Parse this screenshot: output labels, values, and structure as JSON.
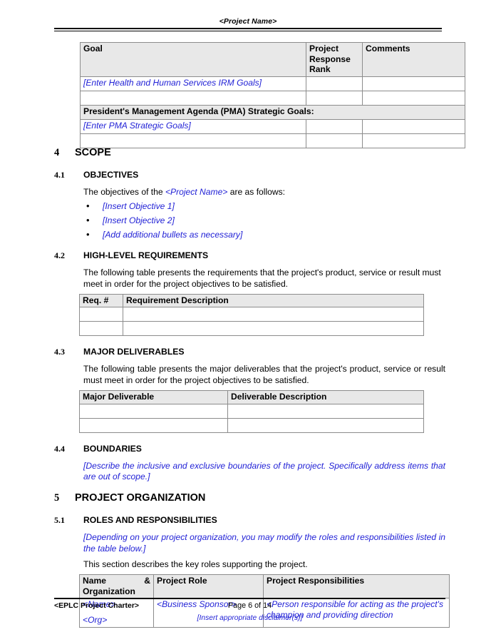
{
  "header": {
    "title": "<Project Name>"
  },
  "goals_table": {
    "columns": [
      "Goal",
      "Project Response Rank",
      "Comments"
    ],
    "col_project_rank_wrapped": "Project\nResponse\nRank",
    "rows": [
      {
        "type": "placeholder",
        "goal": "[Enter Health and Human Services IRM Goals]",
        "rank": "",
        "comments": ""
      },
      {
        "type": "blank",
        "goal": "",
        "rank": "",
        "comments": ""
      },
      {
        "type": "section",
        "goal": "President's Management Agenda (PMA) Strategic Goals:"
      },
      {
        "type": "placeholder",
        "goal": "[Enter PMA Strategic Goals]",
        "rank": "",
        "comments": ""
      },
      {
        "type": "blank",
        "goal": "",
        "rank": "",
        "comments": ""
      }
    ]
  },
  "sections": {
    "scope": {
      "number": "4",
      "title": "SCOPE",
      "objectives": {
        "number": "4.1",
        "title": "OBJECTIVES",
        "intro_before": "The objectives of the ",
        "intro_project": "<Project Name>",
        "intro_after": " are as follows:",
        "bullets": [
          "[Insert Objective 1]",
          "[Insert Objective 2]",
          "[Add additional bullets as necessary]"
        ]
      },
      "requirements": {
        "number": "4.2",
        "title": "HIGH-LEVEL REQUIREMENTS",
        "intro": "The following table presents the requirements that the project's product, service or result must meet in order for the project objectives to be satisfied.",
        "columns": [
          "Req. #",
          "Requirement Description"
        ],
        "rows": [
          [
            "",
            ""
          ],
          [
            "",
            ""
          ]
        ]
      },
      "deliverables": {
        "number": "4.3",
        "title": "MAJOR DELIVERABLES",
        "intro": "The following table presents the major deliverables that the project's product, service or result must meet in order for the project objectives to be satisfied.",
        "columns": [
          "Major Deliverable",
          "Deliverable Description"
        ],
        "rows": [
          [
            "",
            ""
          ],
          [
            "",
            ""
          ]
        ]
      },
      "boundaries": {
        "number": "4.4",
        "title": "BOUNDARIES",
        "placeholder": "[Describe the inclusive and exclusive boundaries of the project.  Specifically address items that are out of scope.]"
      }
    },
    "organization": {
      "number": "5",
      "title": "PROJECT ORGANIZATION",
      "roles": {
        "number": "5.1",
        "title": "ROLES AND RESPONSIBILITIES",
        "placeholder": "[Depending on your project organization, you may modify the roles and responsibilities listed in the table below.]",
        "intro": "This section describes the key roles supporting the project.",
        "columns": [
          "Name",
          "&",
          "Organization",
          "Project Role",
          "Project Responsibilities"
        ],
        "col1_part1": "Name",
        "col1_part2": "&",
        "col1_part3": "Organization",
        "col2": "Project Role",
        "col3": "Project Responsibilities",
        "rows": [
          {
            "name_line1": "<Name>",
            "name_line2": "<Org>",
            "role": "<Business Sponsor>",
            "responsibility": "<Person responsible for acting as the project's champion and providing direction"
          }
        ]
      }
    }
  },
  "footer": {
    "left": "<EPLC Project Charter>",
    "center": "Page 6 of 14",
    "disclaimer": "[Insert appropriate disclaimer(s)]"
  },
  "colors": {
    "placeholder_blue": "#2121d6",
    "table_header_shade": "#e8e8e8",
    "rule": "#000000"
  }
}
